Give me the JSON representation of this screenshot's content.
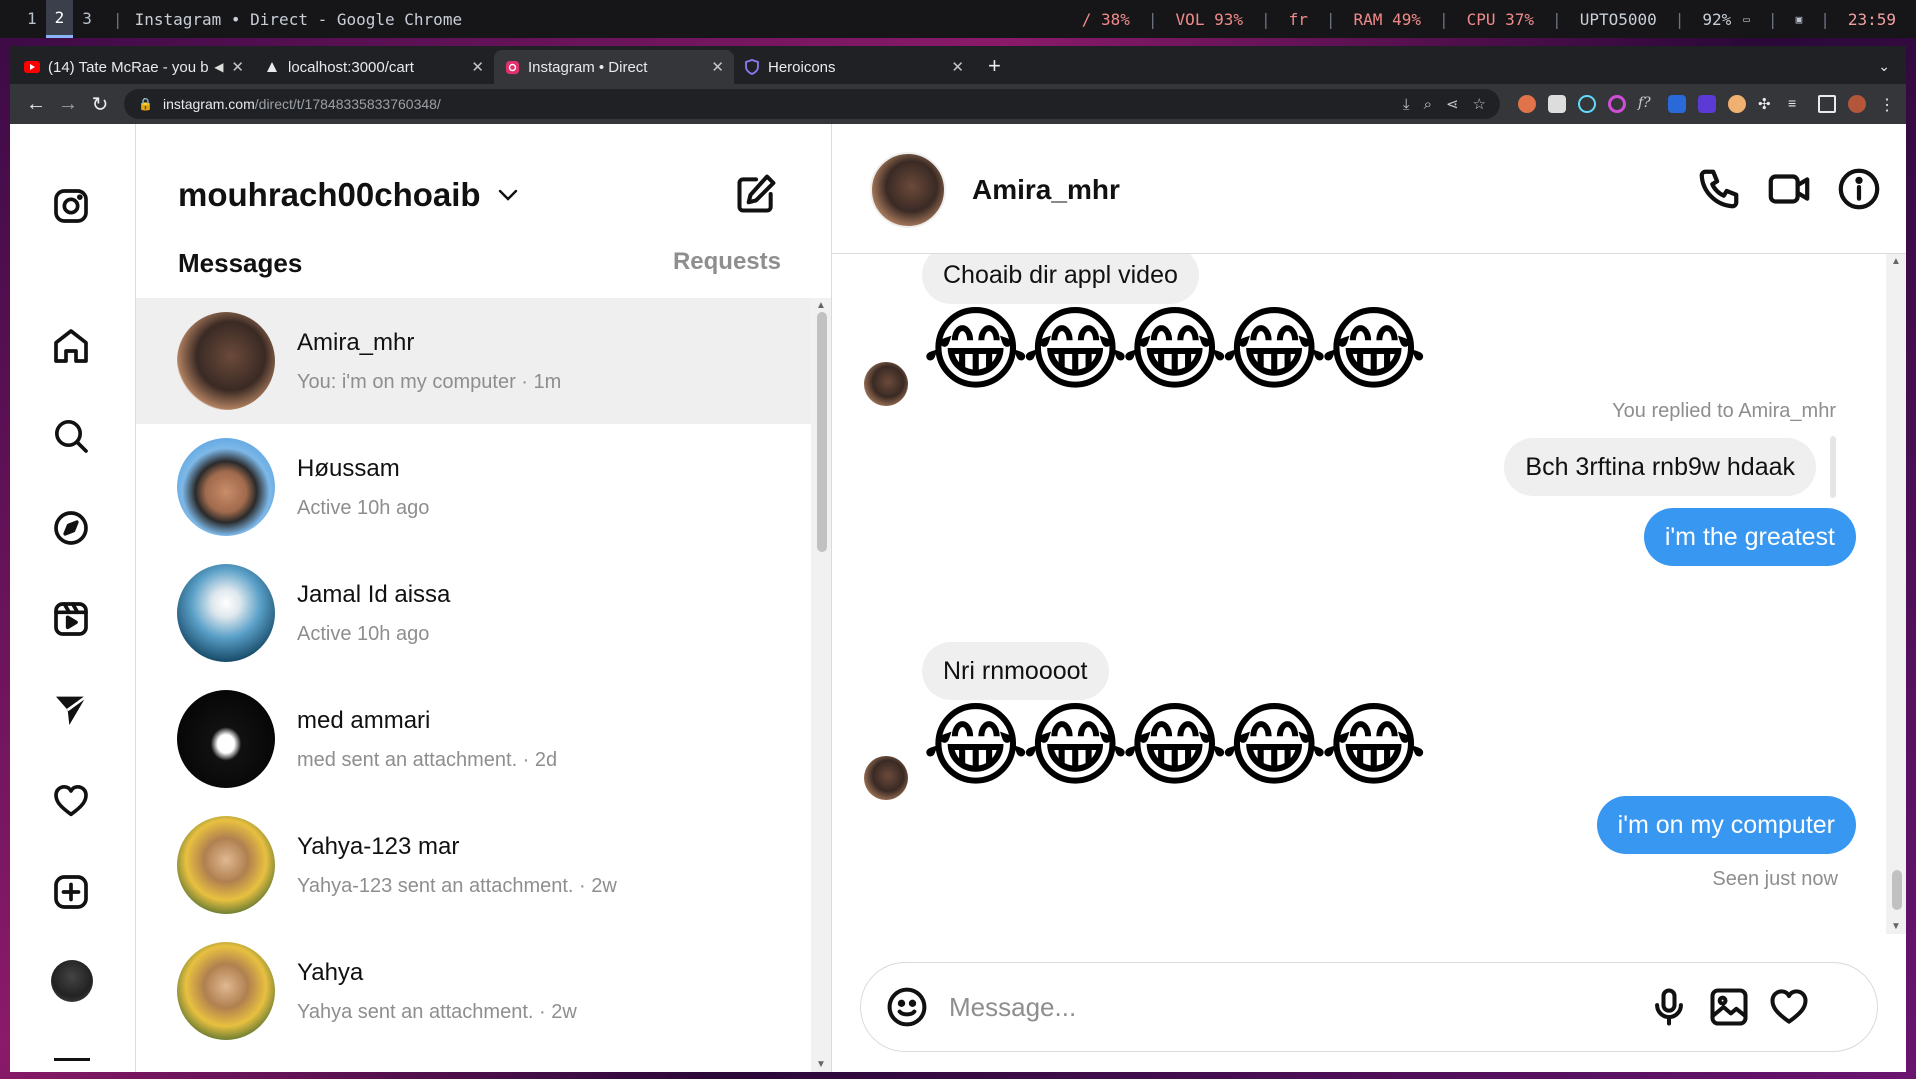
{
  "system_bar": {
    "workspaces": [
      "1",
      "2",
      "3"
    ],
    "window_title": "Instagram • Direct - Google Chrome",
    "disk": "/ 38%",
    "volume": "VOL 93%",
    "lang": "fr",
    "ram": "RAM 49%",
    "cpu": "CPU 37%",
    "host": "UPTO5000",
    "battery": "92%",
    "clock": "23:59"
  },
  "browser": {
    "tabs": [
      {
        "title": "(14) Tate McRae - you b",
        "active": false
      },
      {
        "title": "localhost:3000/cart",
        "active": false
      },
      {
        "title": "Instagram • Direct",
        "active": true
      },
      {
        "title": "Heroicons",
        "active": false
      }
    ],
    "url_host": "instagram.com",
    "url_path": "/direct/t/17848335833760348/"
  },
  "inbox": {
    "account": "mouhrach00choaib",
    "messages_label": "Messages",
    "requests_label": "Requests",
    "conversations": [
      {
        "name": "Amira_mhr",
        "sub": "You: i'm on my computer · 1m",
        "selected": true
      },
      {
        "name": "Høussam",
        "sub": "Active 10h ago"
      },
      {
        "name": "Jamal Id aissa",
        "sub": "Active 10h ago"
      },
      {
        "name": "med ammari",
        "sub": "med sent an attachment. · 2d"
      },
      {
        "name": "Yahya-123 mar",
        "sub": "Yahya-123 sent an attachment. · 2w"
      },
      {
        "name": "Yahya",
        "sub": "Yahya sent an attachment. · 2w"
      }
    ]
  },
  "chat": {
    "name": "Amira_mhr",
    "messages": {
      "m1": "Choaib dir appl video",
      "emoji1": "😂😂😂😂😂",
      "replied_label": "You replied to Amira_mhr",
      "quoted": "Bch 3rftina rnb9w hdaak",
      "m2": "i'm the greatest",
      "m3": "Nri rnmoooot",
      "emoji2": "😂😂😂😂😂",
      "m4": "i'm on my computer",
      "seen": "Seen just now"
    },
    "composer_placeholder": "Message..."
  }
}
